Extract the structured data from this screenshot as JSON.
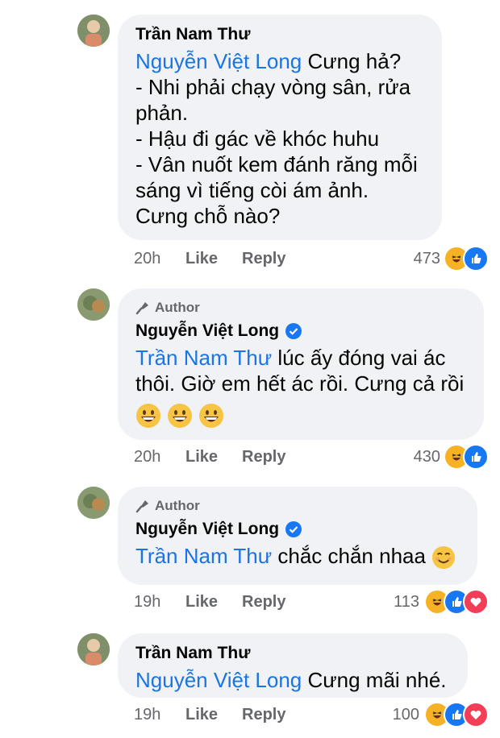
{
  "comments": [
    {
      "name": "Trần Nam Thư",
      "mention": "Nguyễn Việt Long",
      "lines": [
        "Cưng hả?",
        "- Nhi phải chạy vòng sân, rửa",
        "phản.",
        "- Hậu đi gác về khóc huhu",
        "- Vân nuốt kem đánh răng mỗi",
        "sáng vì tiếng còi ám ảnh.",
        "Cưng chỗ nào?"
      ],
      "time": "20h",
      "like": "Like",
      "reply": "Reply",
      "count": "473",
      "reactions": [
        "haha-icon",
        "like-icon"
      ]
    },
    {
      "author_badge": "Author",
      "name": "Nguyễn Việt Long",
      "verified": true,
      "mention": "Trần Nam Thư",
      "lines": [
        "lúc ấy đóng vai ác",
        "thôi. Giờ em hết ác rồi. Cưng cả rồi"
      ],
      "emojis": [
        "grinning-emoji",
        "grinning-emoji",
        "grinning-emoji"
      ],
      "time": "20h",
      "like": "Like",
      "reply": "Reply",
      "count": "430",
      "reactions": [
        "haha-icon",
        "like-icon"
      ]
    },
    {
      "author_badge": "Author",
      "name": "Nguyễn Việt Long",
      "verified": true,
      "mention": "Trần Nam Thư",
      "lines": [
        "chắc chắn nhaa"
      ],
      "emojis": [
        "smiling-emoji"
      ],
      "time": "19h",
      "like": "Like",
      "reply": "Reply",
      "count": "113",
      "reactions": [
        "haha-icon",
        "like-icon",
        "love-icon"
      ]
    },
    {
      "name": "Trần Nam Thư",
      "mention": "Nguyễn Việt Long",
      "lines": [
        "Cưng mãi nhé."
      ],
      "time": "19h",
      "like": "Like",
      "reply": "Reply",
      "count": "100",
      "reactions": [
        "haha-icon",
        "like-icon",
        "love-icon"
      ]
    }
  ],
  "colors": {
    "mention": "#1b74e4",
    "bubble": "#f0f2f5",
    "meta": "#65676b",
    "like": "#1877f2",
    "love": "#f33e58",
    "haha": "#f7b125"
  }
}
